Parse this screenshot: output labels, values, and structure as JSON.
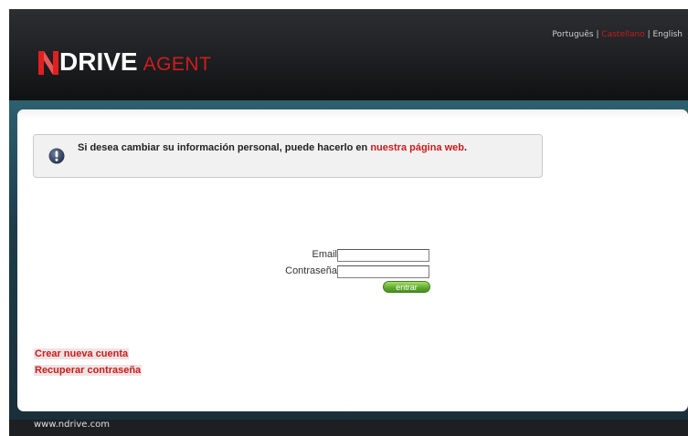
{
  "header": {
    "languages": [
      {
        "label": "Português",
        "active": false
      },
      {
        "label": "Castellano",
        "active": true
      },
      {
        "label": "English",
        "active": false
      }
    ],
    "separator": "|",
    "logo": {
      "brand": "DRIVE",
      "suffix": "AGENT",
      "brand_color": "#ffffff",
      "accent": "#d01d1d"
    }
  },
  "notice": {
    "text": "Si desea cambiar su información personal, puede hacerlo en ",
    "link": "nuestra página web",
    "end": ".",
    "icon": "exclamation-icon"
  },
  "login": {
    "email_label": "Email",
    "email_value": "",
    "password_label": "Contraseña",
    "password_value": "",
    "submit_label": "entrar"
  },
  "links": {
    "create_account": "Crear nueva cuenta",
    "recover_password": "Recuperar contraseña"
  },
  "footer": {
    "url": "www.ndrive.com"
  },
  "colors": {
    "accent": "#c81c1c",
    "button": "#5ea92c",
    "band": "#2d6070"
  }
}
